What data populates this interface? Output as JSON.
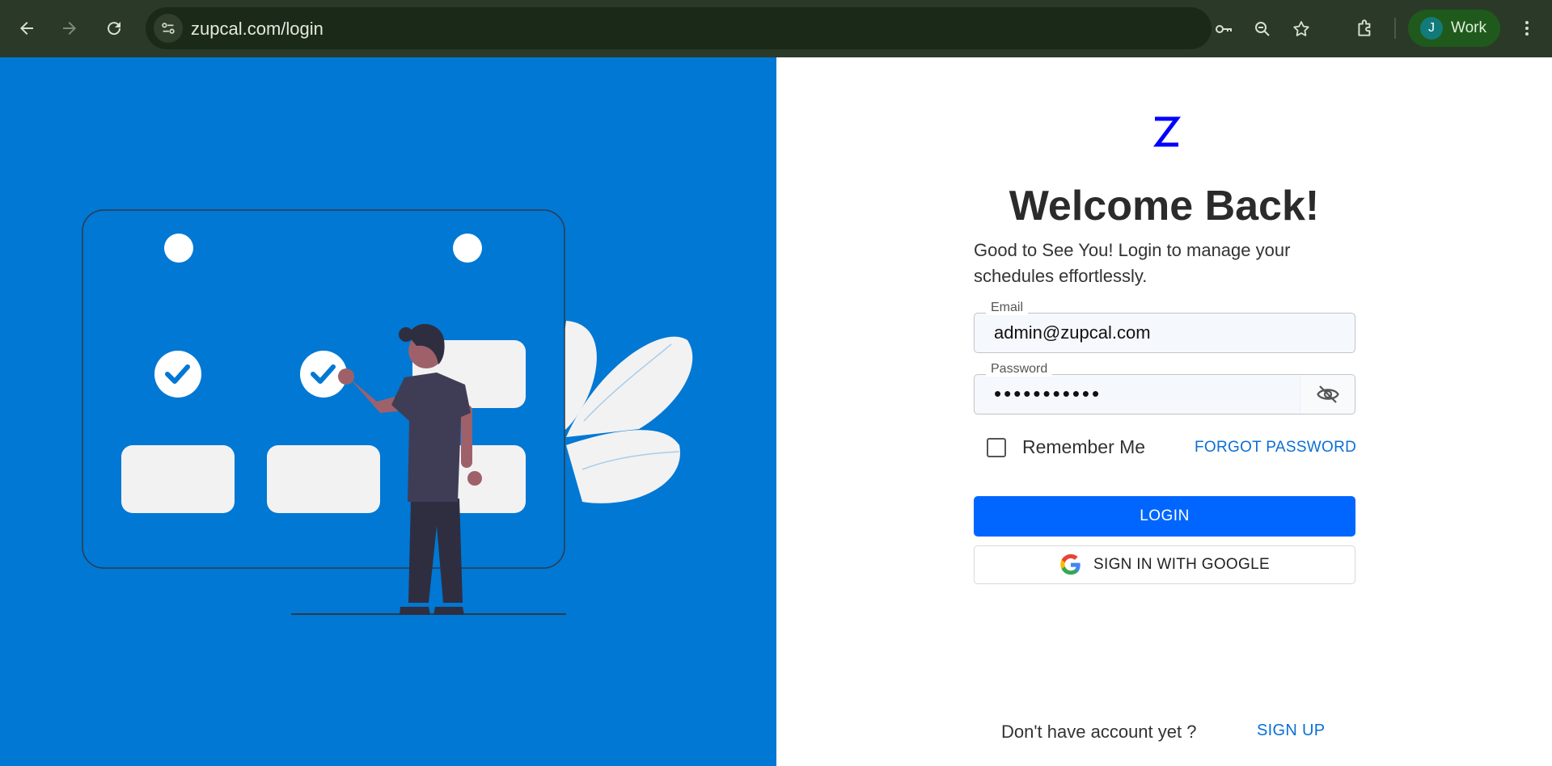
{
  "browser": {
    "url": "zupcal.com/login",
    "profile_initial": "J",
    "profile_name": "Work",
    "icons": [
      "back-icon",
      "forward-icon",
      "reload-icon",
      "site-info-icon",
      "password-key-icon",
      "zoom-icon",
      "bookmark-star-icon",
      "extensions-icon",
      "menu-icon"
    ]
  },
  "brand": {
    "logo_letter": "Z",
    "logo_color": "#0000ff"
  },
  "login": {
    "title": "Welcome Back!",
    "subtitle": "Good to See You! Login to manage your schedules effortlessly.",
    "email_label": "Email",
    "email_value": "admin@zupcal.com",
    "password_label": "Password",
    "password_masked": "•••••••••••",
    "remember_label": "Remember Me",
    "remember_checked": false,
    "forgot_label": "FORGOT PASSWORD",
    "login_label": "LOGIN",
    "google_label": "SIGN IN WITH GOOGLE",
    "no_account_text": "Don't have account yet ?",
    "signup_label": "SIGN UP"
  },
  "colors": {
    "left_panel": "#0078d4",
    "primary_button": "#0066ff",
    "link": "#0a6fd6"
  }
}
